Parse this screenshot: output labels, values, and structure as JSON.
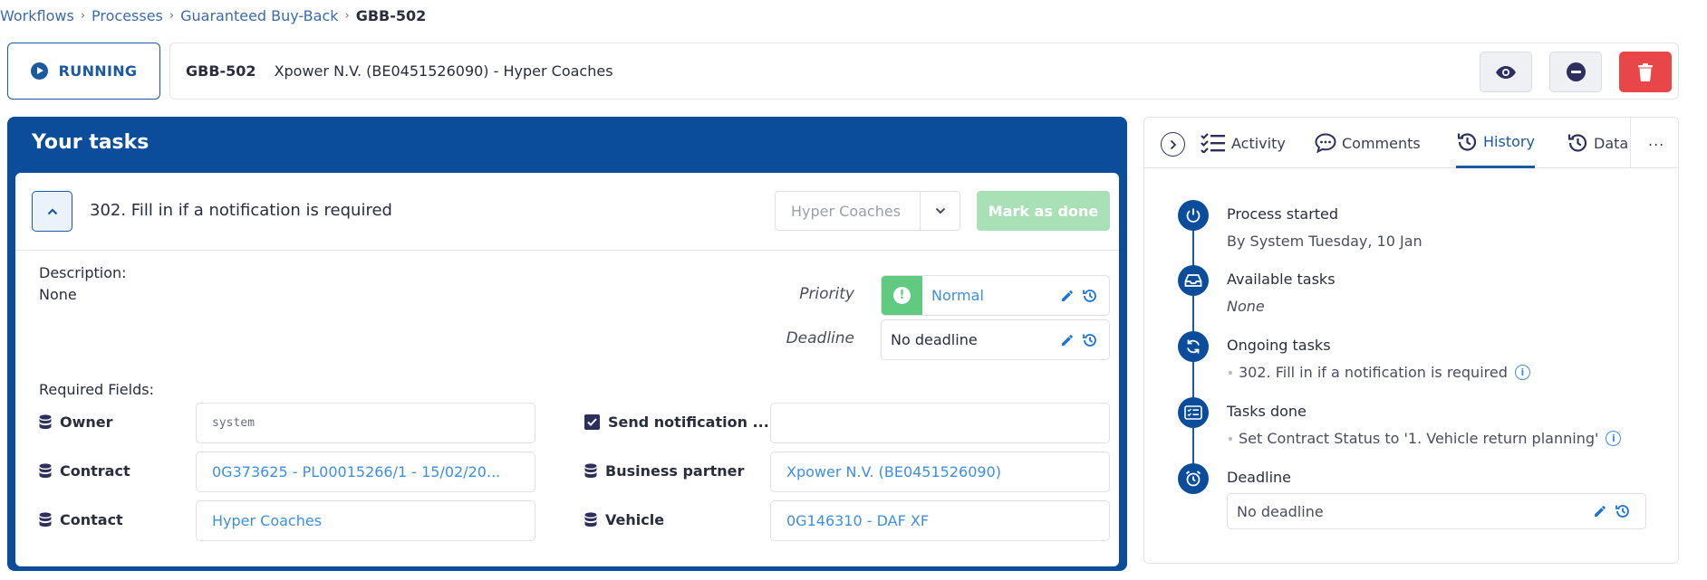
{
  "breadcrumb": {
    "items": [
      "Workflows",
      "Processes",
      "Guaranteed Buy-Back"
    ],
    "current": "GBB-502"
  },
  "header": {
    "status_label": "RUNNING",
    "process_code": "GBB-502",
    "process_title": "Xpower N.V. (BE0451526090) - Hyper Coaches"
  },
  "colors": {
    "primary": "#0b4d9a",
    "link": "#3d8ee6",
    "success": "#5fca80",
    "danger": "#e94649",
    "done_disabled": "#a9e0b6"
  },
  "tasks": {
    "title": "Your tasks",
    "task_title": "302. Fill in if a notification is required",
    "assignee": "Hyper Coaches",
    "mark_done_label": "Mark as done",
    "description_label": "Description:",
    "description_value": "None",
    "priority_label": "Priority",
    "priority_value": "Normal",
    "deadline_label": "Deadline",
    "deadline_value": "No deadline",
    "required_fields_label": "Required Fields:",
    "fields": {
      "owner_label": "Owner",
      "owner_value": "system",
      "contract_label": "Contract",
      "contract_value": "0G373625 - PL00015266/1 - 15/02/20...",
      "contact_label": "Contact",
      "contact_value": "Hyper Coaches",
      "send_notification_label": "Send notification ...",
      "send_notification_value": "",
      "business_partner_label": "Business partner",
      "business_partner_value": "Xpower N.V. (BE0451526090)",
      "vehicle_label": "Vehicle",
      "vehicle_value": "0G146310 - DAF XF"
    }
  },
  "side": {
    "tabs": [
      "Activity",
      "Comments",
      "History",
      "Data"
    ],
    "active_tab": "History",
    "more": "...",
    "timeline": {
      "process_started": "Process started",
      "process_started_by": "By System Tuesday, 10 Jan",
      "available_tasks": "Available tasks",
      "available_tasks_value": "None",
      "ongoing_tasks": "Ongoing tasks",
      "ongoing_task_item": "302. Fill in if a notification is required",
      "tasks_done": "Tasks done",
      "tasks_done_item": "Set Contract Status to '1. Vehicle return planning'",
      "deadline": "Deadline",
      "deadline_value": "No deadline"
    }
  }
}
